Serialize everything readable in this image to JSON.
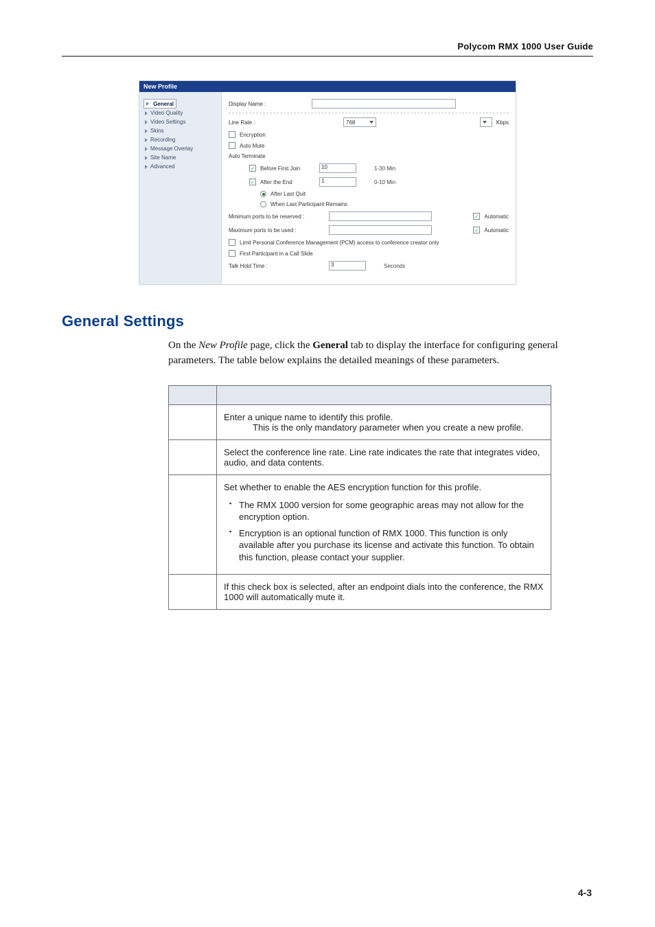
{
  "header": {
    "title": "Polycom RMX 1000 User Guide"
  },
  "screenshot": {
    "windowTitle": "New Profile",
    "nav": {
      "items": [
        {
          "label": "General",
          "selected": true
        },
        {
          "label": "Video Quality"
        },
        {
          "label": "Video Settings"
        },
        {
          "label": "Skins"
        },
        {
          "label": "Recording"
        },
        {
          "label": "Message Overlay"
        },
        {
          "label": "Site Name"
        },
        {
          "label": "Advanced"
        }
      ]
    },
    "form": {
      "displayName": {
        "label": "Display Name :",
        "value": ""
      },
      "lineRate": {
        "label": "Line Rate :",
        "selected": "768",
        "unit": "Kbps"
      },
      "encryption": {
        "label": "Encryption",
        "checked": false
      },
      "autoMute": {
        "label": "Auto Mute",
        "checked": false
      },
      "autoTerminateLabel": "Auto Terminate",
      "beforeFirstJoin": {
        "label": "Before First Join",
        "checked": true,
        "value": "10",
        "hint": "1-30 Min"
      },
      "afterEnd": {
        "label": "After the End",
        "checked": true,
        "value": "1",
        "hint": "0-10 Min"
      },
      "afterLastQuit": {
        "label": "After Last Quit",
        "selected": true
      },
      "whenLastRemains": {
        "label": "When Last Participant Remains",
        "selected": false
      },
      "minPorts": {
        "label": "Minimum ports to be reserved :",
        "value": "",
        "autoLabel": "Automatic",
        "autoChecked": true
      },
      "maxPorts": {
        "label": "Maximum ports to be used :",
        "value": "",
        "autoLabel": "Automatic",
        "autoChecked": true
      },
      "limitPCM": {
        "label": "Limit Personal Conference Management (PCM) access to conference creator only",
        "checked": false
      },
      "firstCallSlide": {
        "label": "First Participant in a Call Slide",
        "checked": false
      },
      "talkHold": {
        "label": "Talk Hold Time :",
        "value": "3",
        "unit": "Seconds"
      }
    }
  },
  "section": {
    "heading": "General Settings",
    "para_pre": "On the ",
    "para_em": "New Profile",
    "para_mid": " page, click the ",
    "para_strong": "General",
    "para_post": " tab to display the interface for configuring general parameters. The table below explains the detailed meanings of these parameters."
  },
  "table": {
    "rows": [
      {
        "desc_line1": "Enter a unique name to identify this profile.",
        "desc_note": "This is the only mandatory parameter when you create a new profile."
      },
      {
        "desc": "Select the conference line rate. Line rate indicates the rate that integrates video, audio, and data contents."
      },
      {
        "desc_line1": "Set whether to enable the AES encryption function for this profile.",
        "bullets": [
          "The RMX 1000 version for some geographic areas may not allow for the encryption option.",
          "Encryption is an optional function of RMX 1000. This function is only available after you purchase its license and activate this function. To obtain this function, please contact your supplier."
        ]
      },
      {
        "desc": "If this check box is selected, after an endpoint dials into the conference, the RMX 1000 will automatically mute it."
      }
    ]
  },
  "footer": {
    "page": "4-3"
  }
}
